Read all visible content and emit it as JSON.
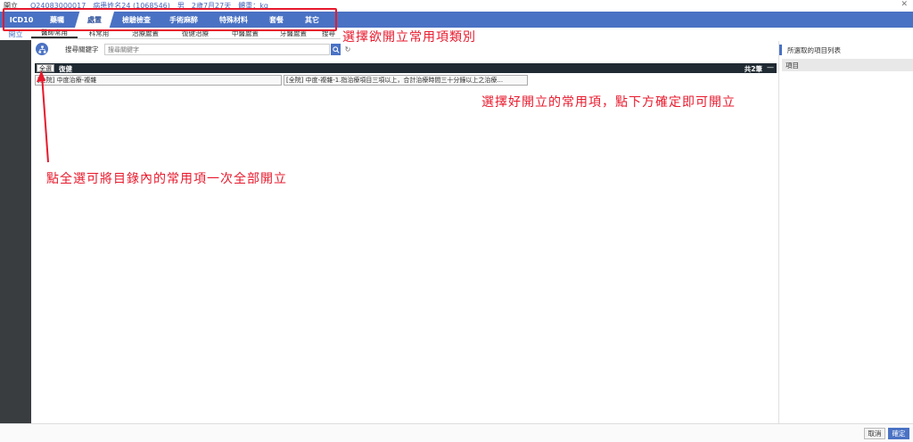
{
  "titlebar": {
    "title": "開立",
    "patient_info": "Q24083000017　病患姓名24 (1068546)　男　2歲7月27天　體重：kg",
    "close_glyph": "✕"
  },
  "topnav": {
    "tabs": [
      {
        "label": "ICD10"
      },
      {
        "label": "藥囑"
      },
      {
        "label": "處置"
      },
      {
        "label": "檢驗檢查"
      },
      {
        "label": "手術麻醉"
      },
      {
        "label": "特殊材料"
      },
      {
        "label": "套餐"
      },
      {
        "label": "其它"
      }
    ],
    "active_index": 2
  },
  "sidebar": {
    "active_item": "開立"
  },
  "subtabs": {
    "tabs": [
      {
        "label": "醫師常用"
      },
      {
        "label": "科常用"
      },
      {
        "label": "治療處置"
      },
      {
        "label": "復健治療"
      },
      {
        "label": "中醫處置"
      },
      {
        "label": "牙醫處置"
      },
      {
        "label": "搜尋"
      }
    ],
    "active_index": 0
  },
  "search": {
    "label": "搜尋關鍵字",
    "placeholder": "搜尋關鍵字",
    "search_icon": "search-icon",
    "refresh_icon": "refresh-icon"
  },
  "group": {
    "select_all": "全選",
    "name": "復健",
    "count": "共2筆",
    "collapse_glyph": "—"
  },
  "items": [
    {
      "label": "[全院] 中度治療-複雜"
    },
    {
      "label": "[全院] 中度-複雜-1.指治療項目三項以上，合計治療時間三十分鐘以上之治療..."
    }
  ],
  "rightpanel": {
    "title": "所選取的項目列表",
    "column": "項目"
  },
  "footer": {
    "cancel": "取消",
    "confirm": "確定"
  },
  "annotations": {
    "category_hint": "選擇欲開立常用項類別",
    "confirm_hint": "選擇好開立的常用項，點下方確定即可開立",
    "selectall_hint": "點全選可將目錄內的常用項一次全部開立"
  },
  "colors": {
    "accent": "#4a72c4",
    "annotation": "#e8192c",
    "sidebar": "#3a3d40",
    "group_bar": "#1f2a32"
  }
}
